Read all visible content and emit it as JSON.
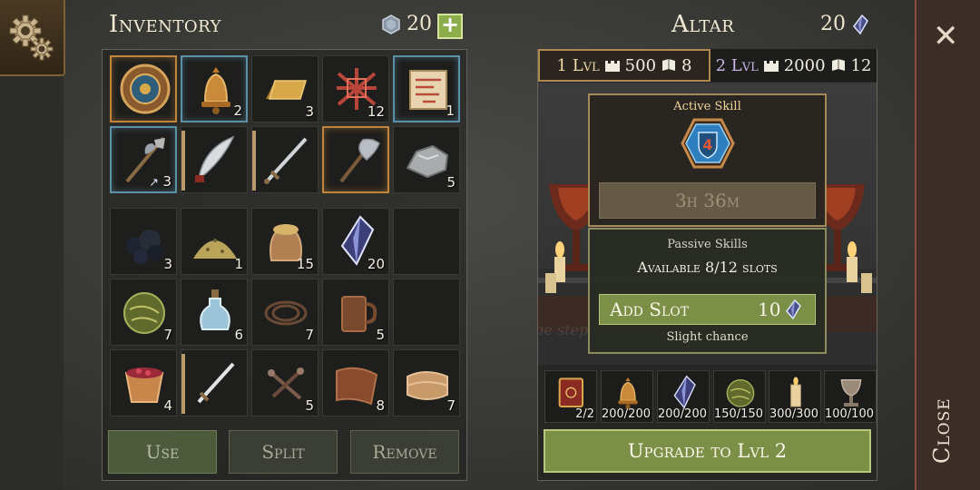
{
  "inventory": {
    "title": "Inventory",
    "gem_count": "20",
    "plus_label": "+",
    "buttons": {
      "use": "Use",
      "split": "Split",
      "remove": "Remove"
    },
    "slots": [
      {
        "icon": "round-shield-icon",
        "qty": "",
        "rarity": "orange"
      },
      {
        "icon": "bell-icon",
        "qty": "2",
        "rarity": "blue"
      },
      {
        "icon": "gold-ingot-icon",
        "qty": "3",
        "rarity": ""
      },
      {
        "icon": "red-rune-bundle-icon",
        "qty": "12",
        "rarity": ""
      },
      {
        "icon": "scroll-map-icon",
        "qty": "1",
        "rarity": "blue"
      },
      {
        "icon": "halberd-icon",
        "qty": "3",
        "rarity": "blue",
        "badge": "↗"
      },
      {
        "icon": "scimitar-icon",
        "qty": "",
        "rarity": "bar-tan"
      },
      {
        "icon": "long-sword-icon",
        "qty": "",
        "rarity": "bar-tan"
      },
      {
        "icon": "battle-axe-icon",
        "qty": "",
        "rarity": "orange"
      },
      {
        "icon": "stone-ore-icon",
        "qty": "5",
        "rarity": ""
      },
      {
        "icon": "coal-icon",
        "qty": "3",
        "rarity": ""
      },
      {
        "icon": "sand-pile-icon",
        "qty": "1",
        "rarity": ""
      },
      {
        "icon": "grain-sack-icon",
        "qty": "15",
        "rarity": ""
      },
      {
        "icon": "crystal-icon",
        "qty": "20",
        "rarity": ""
      },
      {
        "icon": "empty-slot",
        "qty": "",
        "rarity": ""
      },
      {
        "icon": "herb-ball-icon",
        "qty": "7",
        "rarity": ""
      },
      {
        "icon": "potion-flask-icon",
        "qty": "6",
        "rarity": ""
      },
      {
        "icon": "rope-icon",
        "qty": "7",
        "rarity": ""
      },
      {
        "icon": "wooden-mug-icon",
        "qty": "5",
        "rarity": ""
      },
      {
        "icon": "empty-slot",
        "qty": "",
        "rarity": ""
      },
      {
        "icon": "berry-bucket-icon",
        "qty": "4",
        "rarity": ""
      },
      {
        "icon": "steel-sword-icon",
        "qty": "",
        "rarity": "bar-tan"
      },
      {
        "icon": "nails-icon",
        "qty": "5",
        "rarity": ""
      },
      {
        "icon": "leather-icon",
        "qty": "8",
        "rarity": ""
      },
      {
        "icon": "cloth-bolt-icon",
        "qty": "7",
        "rarity": ""
      }
    ]
  },
  "altar": {
    "title": "Altar",
    "gem_count": "20",
    "tabs": [
      {
        "level": "1 Lvl",
        "cost1": "500",
        "cost2": "8"
      },
      {
        "level": "2 Lvl",
        "cost1": "2000",
        "cost2": "12"
      }
    ],
    "active_skill_label": "Active Skill",
    "skill_number": "4",
    "timer": "3h 36m",
    "passive_skills_label": "Passive Skills",
    "available_slots": "Available 8/12 slots",
    "add_slot_label": "Add Slot",
    "add_slot_cost": "10",
    "chance_label": "Slight chance",
    "hint_text": "One step closer to the goal",
    "requirements": [
      {
        "icon": "spell-book-icon",
        "qty": "2/2"
      },
      {
        "icon": "bell-icon",
        "qty": "200/200"
      },
      {
        "icon": "crystal-icon",
        "qty": "200/200"
      },
      {
        "icon": "herb-ball-icon",
        "qty": "150/150"
      },
      {
        "icon": "candle-icon",
        "qty": "300/300"
      },
      {
        "icon": "chalice-icon",
        "qty": "100/100"
      }
    ],
    "upgrade_label": "Upgrade to Lvl 2"
  },
  "close_label": "Close",
  "colors": {
    "accent_green": "#7b8f47",
    "rarity_orange": "#c1843a",
    "rarity_blue": "#5c90a8",
    "close_border": "#8b4a3f"
  }
}
